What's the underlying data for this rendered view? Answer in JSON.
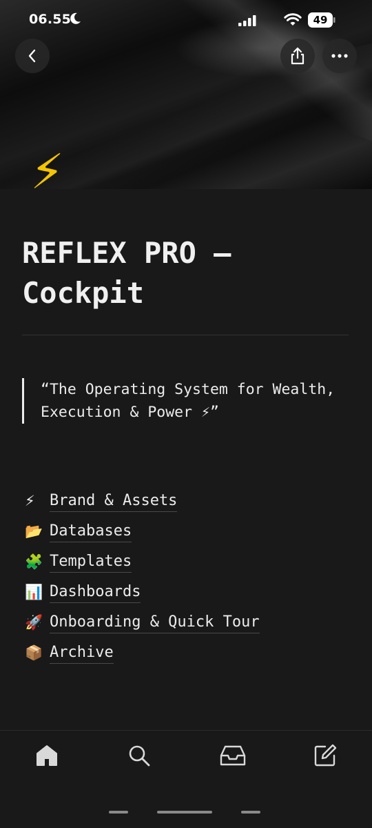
{
  "status_bar": {
    "time": "06.55",
    "battery": "49"
  },
  "page": {
    "icon": "⚡",
    "title": "REFLEX PRO — Cockpit",
    "quote": "“The Operating System for Wealth, Execution & Power ⚡”"
  },
  "links": [
    {
      "emoji": "⚡",
      "label": "Brand & Assets"
    },
    {
      "emoji": "📂",
      "label": "Databases"
    },
    {
      "emoji": "🧩",
      "label": "Templates"
    },
    {
      "emoji": "📊",
      "label": "Dashboards"
    },
    {
      "emoji": "🚀",
      "label": "Onboarding & Quick Tour"
    },
    {
      "emoji": "📦",
      "label": "Archive"
    }
  ],
  "icons": {
    "top_bar": [
      "back-icon",
      "share-icon",
      "more-icon"
    ],
    "bottom_nav": [
      "home-icon",
      "search-icon",
      "inbox-icon",
      "compose-icon"
    ]
  },
  "colors": {
    "background": "#191919",
    "text": "#ececec",
    "accent": "#f5c400"
  }
}
